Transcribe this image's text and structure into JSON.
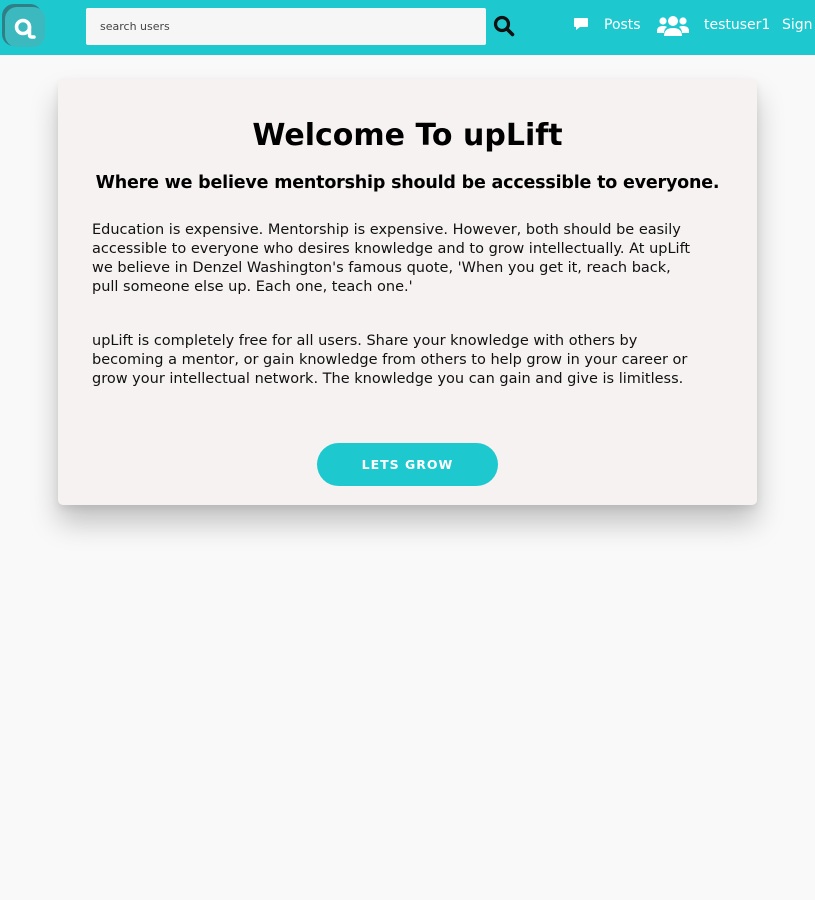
{
  "theme": {
    "accent": "#1dc9cf",
    "background": "#f9f9f9",
    "card_background": "#f6f2f1"
  },
  "header": {
    "logo_icon": "uplift-logo-icon",
    "search": {
      "placeholder": "search users",
      "value": "",
      "icon": "search-icon"
    },
    "nav": {
      "posts_icon": "comment-icon",
      "posts_label": "Posts",
      "users_icon": "users-icon",
      "user_label": "testuser1",
      "sign_label": "Sign"
    }
  },
  "main": {
    "title": "Welcome To upLift",
    "subtitle": "Where we believe mentorship should be accessible to everyone.",
    "paragraphs": [
      "Education is expensive. Mentorship is expensive. However, both should be easily accessible to everyone who desires knowledge and to grow intellectually. At upLift we believe in Denzel Washington's famous quote, 'When you get it, reach back, pull someone else up. Each one, teach one.'",
      "upLift is completely free for all users. Share your knowledge with others by becoming a mentor, or gain knowledge from others to help grow in your career or grow your intellectual network. The knowledge you can gain and give is limitless."
    ],
    "cta_label": "LETS GROW"
  }
}
